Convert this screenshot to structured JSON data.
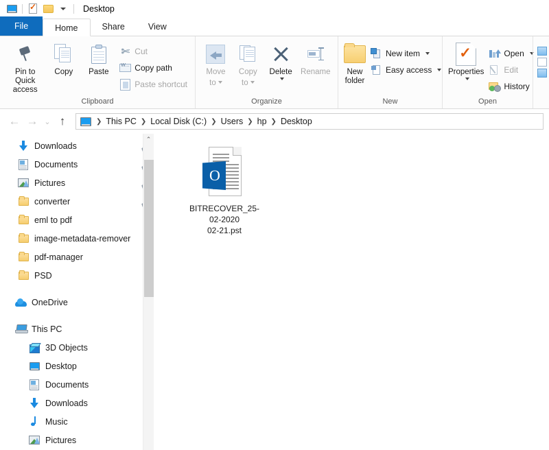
{
  "titlebar": {
    "icons": [
      "desktop-monitor-icon",
      "properties-icon",
      "new-folder-icon",
      "customize-quick-access-caret"
    ],
    "title": "Desktop"
  },
  "tabs": [
    {
      "label": "File",
      "state": "file"
    },
    {
      "label": "Home",
      "state": "active"
    },
    {
      "label": "Share",
      "state": "normal"
    },
    {
      "label": "View",
      "state": "normal"
    }
  ],
  "ribbon": {
    "groups": [
      {
        "name": "Clipboard",
        "label": "Clipboard",
        "big": [
          {
            "label": "Pin to Quick\naccess",
            "line1": "Pin to Quick",
            "line2": "access",
            "icon": "pin-icon",
            "disabled": false
          },
          {
            "label": "Copy",
            "line1": "Copy",
            "line2": "",
            "icon": "copy-icon",
            "disabled": false
          },
          {
            "label": "Paste",
            "line1": "Paste",
            "line2": "",
            "icon": "paste-icon",
            "disabled": false
          }
        ],
        "small": [
          {
            "label": "Cut",
            "icon": "scissors-icon",
            "disabled": true
          },
          {
            "label": "Copy path",
            "icon": "copy-path-icon",
            "disabled": false
          },
          {
            "label": "Paste shortcut",
            "icon": "paste-shortcut-icon",
            "disabled": true
          }
        ]
      },
      {
        "name": "Organize",
        "label": "Organize",
        "big": [
          {
            "line1": "Move",
            "line2": "to",
            "icon": "move-to-icon",
            "disabled": true,
            "caret": true
          },
          {
            "line1": "Copy",
            "line2": "to",
            "icon": "copy-to-icon",
            "disabled": true,
            "caret": true
          },
          {
            "line1": "Delete",
            "line2": "",
            "icon": "delete-icon",
            "disabled": false,
            "caret": true
          },
          {
            "line1": "Rename",
            "line2": "",
            "icon": "rename-icon",
            "disabled": true,
            "caret": false
          }
        ]
      },
      {
        "name": "New",
        "label": "New",
        "big": [
          {
            "line1": "New",
            "line2": "folder",
            "icon": "new-folder-icon",
            "disabled": false
          }
        ],
        "small": [
          {
            "label": "New item",
            "icon": "new-item-icon",
            "disabled": false,
            "caret": true
          },
          {
            "label": "Easy access",
            "icon": "easy-access-icon",
            "disabled": false,
            "caret": true
          }
        ]
      },
      {
        "name": "Open",
        "label": "Open",
        "big": [
          {
            "line1": "Properties",
            "line2": "",
            "icon": "properties-icon",
            "disabled": false,
            "caret": true
          }
        ],
        "small": [
          {
            "label": "Open",
            "icon": "open-icon",
            "disabled": false,
            "caret": true
          },
          {
            "label": "Edit",
            "icon": "edit-icon",
            "disabled": true
          },
          {
            "label": "History",
            "icon": "history-icon",
            "disabled": false
          }
        ]
      }
    ]
  },
  "addressbar": {
    "back": "←",
    "forward": "→",
    "recent": "⌄",
    "up": "↑",
    "breadcrumbs": [
      "This PC",
      "Local Disk (C:)",
      "Users",
      "hp",
      "Desktop"
    ],
    "separator": "❯"
  },
  "navpane": {
    "quick_access": [
      {
        "label": "Downloads",
        "icon": "downloads-icon",
        "pinned": true
      },
      {
        "label": "Documents",
        "icon": "documents-icon",
        "pinned": true
      },
      {
        "label": "Pictures",
        "icon": "pictures-icon",
        "pinned": true
      },
      {
        "label": "converter",
        "icon": "folder-icon",
        "pinned": true
      },
      {
        "label": "eml to pdf",
        "icon": "folder-icon",
        "pinned": false
      },
      {
        "label": "image-metadata-remover",
        "icon": "folder-icon",
        "pinned": false
      },
      {
        "label": "pdf-manager",
        "icon": "folder-icon",
        "pinned": false
      },
      {
        "label": "PSD",
        "icon": "folder-icon",
        "pinned": false
      }
    ],
    "onedrive": {
      "label": "OneDrive",
      "icon": "onedrive-icon"
    },
    "thispc": {
      "label": "This PC",
      "icon": "this-pc-icon"
    },
    "thispc_children": [
      {
        "label": "3D Objects",
        "icon": "3d-objects-icon"
      },
      {
        "label": "Desktop",
        "icon": "desktop-icon"
      },
      {
        "label": "Documents",
        "icon": "documents-icon"
      },
      {
        "label": "Downloads",
        "icon": "downloads-icon"
      },
      {
        "label": "Music",
        "icon": "music-icon"
      },
      {
        "label": "Pictures",
        "icon": "pictures-icon"
      }
    ],
    "scroll_up_glyph": "⌃"
  },
  "files": [
    {
      "name": "BITRECOVER_25-02-2020 02-21.pst",
      "line1": "BITRECOVER_25-",
      "line2": "02-2020",
      "line3": "02-21.pst",
      "icon": "outlook-pst-file-icon",
      "badge_letter": "O"
    }
  ],
  "colors": {
    "accent_blue": "#0f6cbd",
    "outlook_blue": "#0a5fa8",
    "folder_yellow": "#f6cd6f",
    "ribbon_bg": "#fcfcfc"
  }
}
